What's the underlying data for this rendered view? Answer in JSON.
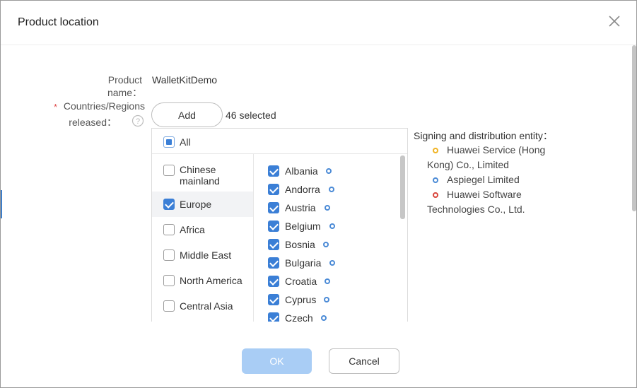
{
  "dialog": {
    "title": "Product location",
    "close_icon": "close-icon"
  },
  "form": {
    "product_name_label": "Product name：",
    "product_name_value": "WalletKitDemo",
    "required_mark": "*",
    "countries_label_line1": "Countries/Regions",
    "countries_label_line2": "released：",
    "help_icon": "question-circle-icon",
    "add_label": "Add",
    "selected_count": "46 selected"
  },
  "picker": {
    "all_label": "All",
    "regions": [
      {
        "label": "Chinese mainland",
        "checked": false
      },
      {
        "label": "Europe",
        "checked": true,
        "active": true
      },
      {
        "label": "Africa",
        "checked": false
      },
      {
        "label": "Middle East",
        "checked": false
      },
      {
        "label": "North America",
        "checked": false
      },
      {
        "label": "Central Asia",
        "checked": false
      }
    ],
    "countries": [
      {
        "label": "Albania",
        "checked": true
      },
      {
        "label": "Andorra",
        "checked": true
      },
      {
        "label": "Austria",
        "checked": true
      },
      {
        "label": "Belgium",
        "checked": true
      },
      {
        "label": "Bosnia",
        "checked": true
      },
      {
        "label": "Bulgaria",
        "checked": true
      },
      {
        "label": "Croatia",
        "checked": true
      },
      {
        "label": "Cyprus",
        "checked": true
      },
      {
        "label": "Czech",
        "checked": true
      }
    ]
  },
  "legend": {
    "title": "Signing and distribution entity：",
    "entities": [
      {
        "lines": [
          "Huawei Service (Hong",
          "Kong) Co., Limited"
        ],
        "color": "#f0b323"
      },
      {
        "lines": [
          "Aspiegel Limited"
        ],
        "color": "#4a8ad6"
      },
      {
        "lines": [
          "Huawei Software",
          "Technologies Co., Ltd."
        ],
        "color": "#d9453b"
      }
    ]
  },
  "footer": {
    "ok_label": "OK",
    "cancel_label": "Cancel"
  },
  "colors": {
    "accent": "#3b7fd6",
    "ok_disabled": "#a9cdf5"
  }
}
